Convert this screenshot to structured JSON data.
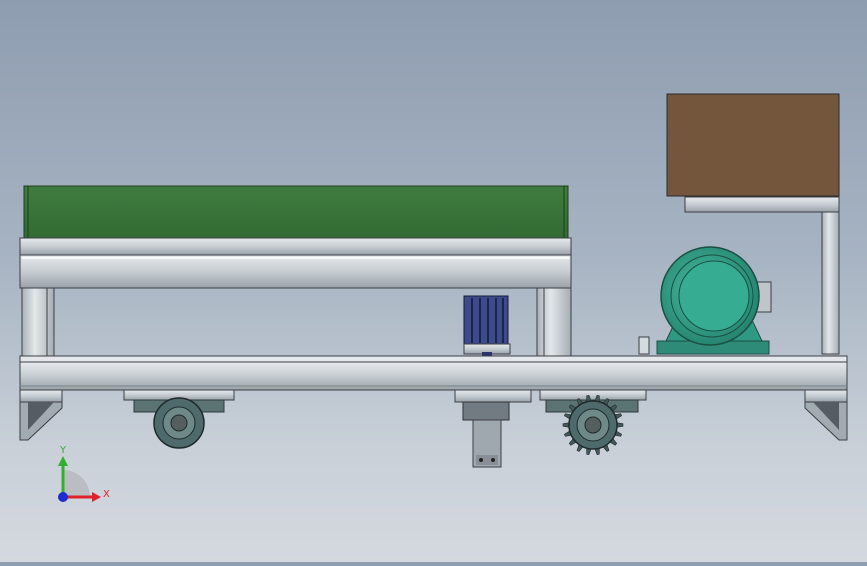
{
  "view": {
    "background_top": "#8e9db0",
    "background_bottom": "#d4d9de"
  },
  "parts": {
    "green_deck_color": "#3a733a",
    "frame_color": "#c9cfd3",
    "frame_edge_color": "#3b3f44",
    "cabinet_color": "#73563c",
    "motor_color": "#33a78e",
    "gear_color": "#4f6a6a",
    "blue_component_color": "#3c4b8a"
  },
  "triad": {
    "x_label": "X",
    "y_label": "Y",
    "x_color": "#e0202a",
    "y_color": "#2fb02f",
    "z_color": "#1d2bd0"
  }
}
